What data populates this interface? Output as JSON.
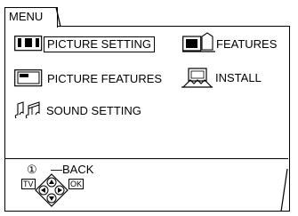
{
  "menu": {
    "tab_label": "MENU"
  },
  "items": [
    {
      "label": "PICTURE SETTING",
      "icon": "picture-setting-icon",
      "selected": true
    },
    {
      "label": "FEATURES",
      "icon": "features-icon"
    },
    {
      "label": "PICTURE FEATURES",
      "icon": "picture-features-icon"
    },
    {
      "label": "INSTALL",
      "icon": "install-icon"
    },
    {
      "label": "SOUND SETTING",
      "icon": "sound-setting-icon"
    }
  ],
  "controls": {
    "back_symbol": "①",
    "back_label": "—BACK",
    "tv_label": "TV",
    "ok_label": "OK"
  }
}
